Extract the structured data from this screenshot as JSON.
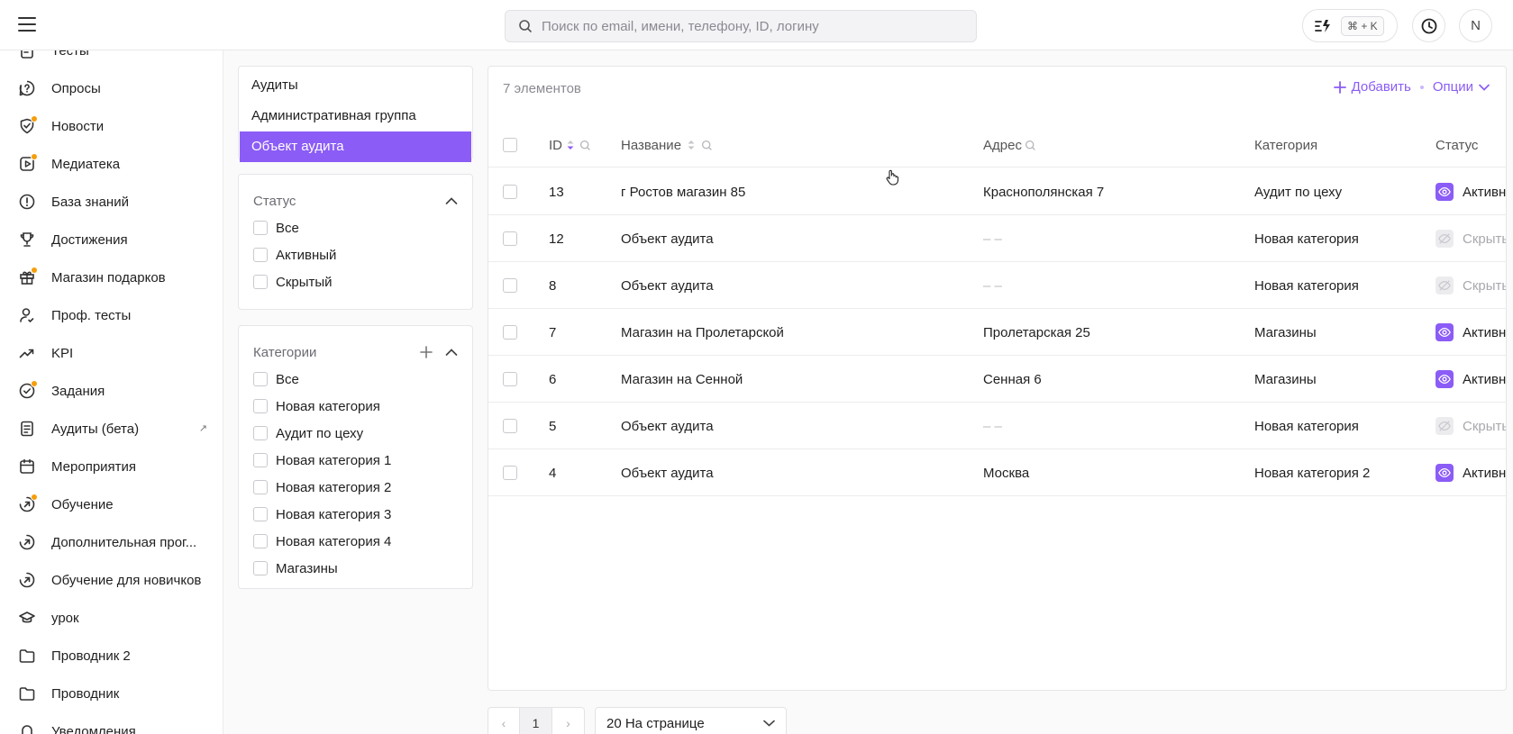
{
  "topbar": {
    "search_placeholder": "Поиск по email, имени, телефону, ID, логину",
    "shortcut": "⌘ + K",
    "avatar_initial": "N"
  },
  "sidebar": {
    "items": [
      {
        "label": "Тесты",
        "icon": "test-icon",
        "dot": false
      },
      {
        "label": "Опросы",
        "icon": "question-bubble-icon",
        "dot": false
      },
      {
        "label": "Новости",
        "icon": "news-icon",
        "dot": true
      },
      {
        "label": "Медиатека",
        "icon": "media-icon",
        "dot": true
      },
      {
        "label": "База знаний",
        "icon": "info-circle-icon",
        "dot": false
      },
      {
        "label": "Достижения",
        "icon": "trophy-icon",
        "dot": false
      },
      {
        "label": "Магазин подарков",
        "icon": "gift-icon",
        "dot": true
      },
      {
        "label": "Проф. тесты",
        "icon": "person-check-icon",
        "dot": false
      },
      {
        "label": "KPI",
        "icon": "trend-icon",
        "dot": false
      },
      {
        "label": "Задания",
        "icon": "task-circle-icon",
        "dot": true
      },
      {
        "label": "Аудиты (бета)",
        "icon": "document-icon",
        "dot": false,
        "external": "↗"
      },
      {
        "label": "Мероприятия",
        "icon": "calendar-icon",
        "dot": false
      },
      {
        "label": "Обучение",
        "icon": "learning-icon",
        "dot": true
      },
      {
        "label": "Дополнительная прог...",
        "icon": "learning-icon",
        "dot": false
      },
      {
        "label": "Обучение для новичков",
        "icon": "learning-icon",
        "dot": false
      },
      {
        "label": "урок",
        "icon": "graduation-cap-icon",
        "dot": false
      },
      {
        "label": "Проводник 2",
        "icon": "folder-icon",
        "dot": false
      },
      {
        "label": "Проводник",
        "icon": "folder-icon",
        "dot": false
      },
      {
        "label": "Уведомления",
        "icon": "bell-icon",
        "dot": false
      }
    ]
  },
  "types": {
    "items": [
      {
        "label": "Аудиты",
        "active": false
      },
      {
        "label": "Административная группа",
        "active": false
      },
      {
        "label": "Объект аудита",
        "active": true
      }
    ]
  },
  "status_filter": {
    "title": "Статус",
    "options": [
      "Все",
      "Активный",
      "Скрытый"
    ]
  },
  "category_filter": {
    "title": "Категории",
    "options": [
      "Все",
      "Новая категория",
      "Аудит по цеху",
      "Новая категория 1",
      "Новая категория 2",
      "Новая категория 3",
      "Новая категория 4",
      "Магазины"
    ]
  },
  "table": {
    "count_label": "7 элементов",
    "add_label": "Добавить",
    "options_label": "Опции",
    "columns": {
      "id": "ID",
      "name": "Название",
      "address": "Адрес",
      "category": "Категория",
      "status": "Статус"
    },
    "rows": [
      {
        "id": "13",
        "name": "г Ростов магазин 85",
        "address": "Краснополянская 7",
        "category": "Аудит по цеху",
        "status": "Активный",
        "active": true
      },
      {
        "id": "12",
        "name": "Объект аудита",
        "address": "– –",
        "category": "Новая категория",
        "status": "Скрытый",
        "active": false
      },
      {
        "id": "8",
        "name": "Объект аудита",
        "address": "– –",
        "category": "Новая категория",
        "status": "Скрытый",
        "active": false
      },
      {
        "id": "7",
        "name": "Магазин на Пролетарской",
        "address": "Пролетарская 25",
        "category": "Магазины",
        "status": "Активный",
        "active": true
      },
      {
        "id": "6",
        "name": "Магазин на Сенной",
        "address": "Сенная 6",
        "category": "Магазины",
        "status": "Активный",
        "active": true
      },
      {
        "id": "5",
        "name": "Объект аудита",
        "address": "– –",
        "category": "Новая категория",
        "status": "Скрытый",
        "active": false
      },
      {
        "id": "4",
        "name": "Объект аудита",
        "address": "Москва",
        "category": "Новая категория 2",
        "status": "Активный",
        "active": true
      }
    ]
  },
  "pagination": {
    "current_page": "1",
    "prev": "‹",
    "next": "›",
    "per_page": "20 На странице"
  },
  "colors": {
    "accent": "#8b5cf6",
    "dot": "#f59e0b"
  }
}
